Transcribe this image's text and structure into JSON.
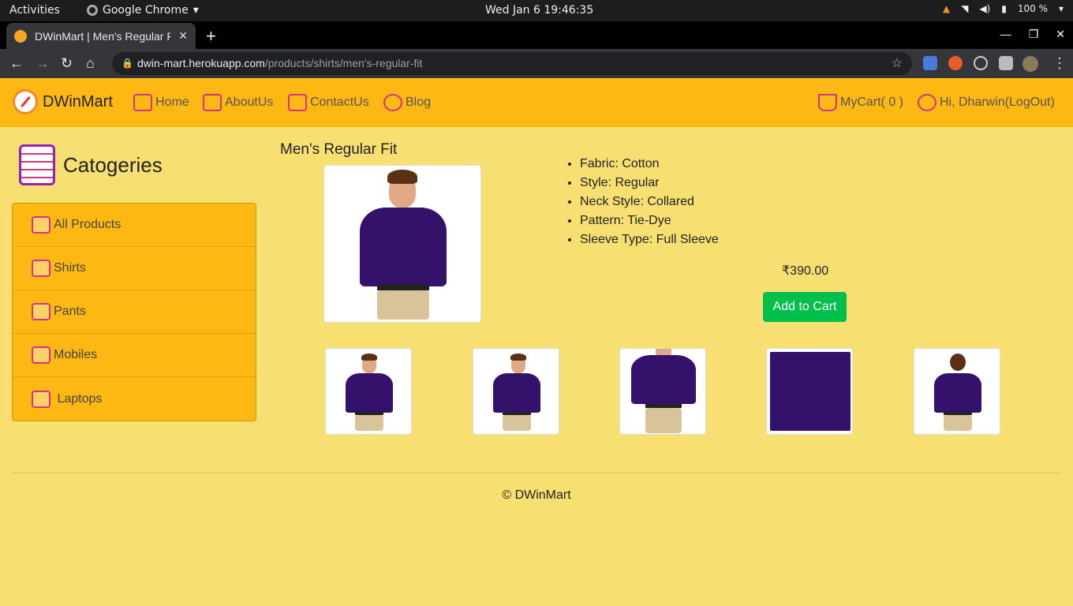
{
  "os": {
    "activities": "Activities",
    "app_name": "Google Chrome",
    "clock": "Wed Jan 6  19:46:35",
    "battery": "100 %"
  },
  "browser": {
    "tab_title": "DWinMart | Men's Regular Fit",
    "url_host": "dwin-mart.herokuapp.com",
    "url_path": "/products/shirts/men's-regular-fit"
  },
  "nav": {
    "brand": "DWinMart",
    "home": "Home",
    "about": "AboutUs",
    "contact": "ContactUs",
    "blog": "Blog",
    "cart": "MyCart( 0 )",
    "user": "Hi, Dharwin(LogOut)"
  },
  "sidebar": {
    "heading": "Catogeries",
    "items": [
      {
        "label": "All Products",
        "icon": "list-icon"
      },
      {
        "label": "Shirts",
        "icon": "box-icon"
      },
      {
        "label": "Pants",
        "icon": "box-icon"
      },
      {
        "label": "Mobiles",
        "icon": "box-icon"
      },
      {
        "label": " Laptops",
        "icon": "box-icon"
      }
    ]
  },
  "product": {
    "title": "Men's Regular Fit",
    "features": [
      "Fabric: Cotton",
      "Style: Regular",
      "Neck Style: Collared",
      "Pattern: Tie-Dye",
      "Sleeve Type: Full Sleeve"
    ],
    "price": "₹390.00",
    "add_to_cart": "Add to Cart",
    "thumbnails": [
      "front",
      "front-angle",
      "front-close",
      "fabric-detail",
      "back"
    ]
  },
  "footer": {
    "copyright": "© DWinMart"
  },
  "colors": {
    "page_bg": "#f8df72",
    "navbar_bg": "#fdb813",
    "button_green": "#00c04b",
    "icon_pink": "#d63384",
    "shirt_purple": "#34116b"
  }
}
